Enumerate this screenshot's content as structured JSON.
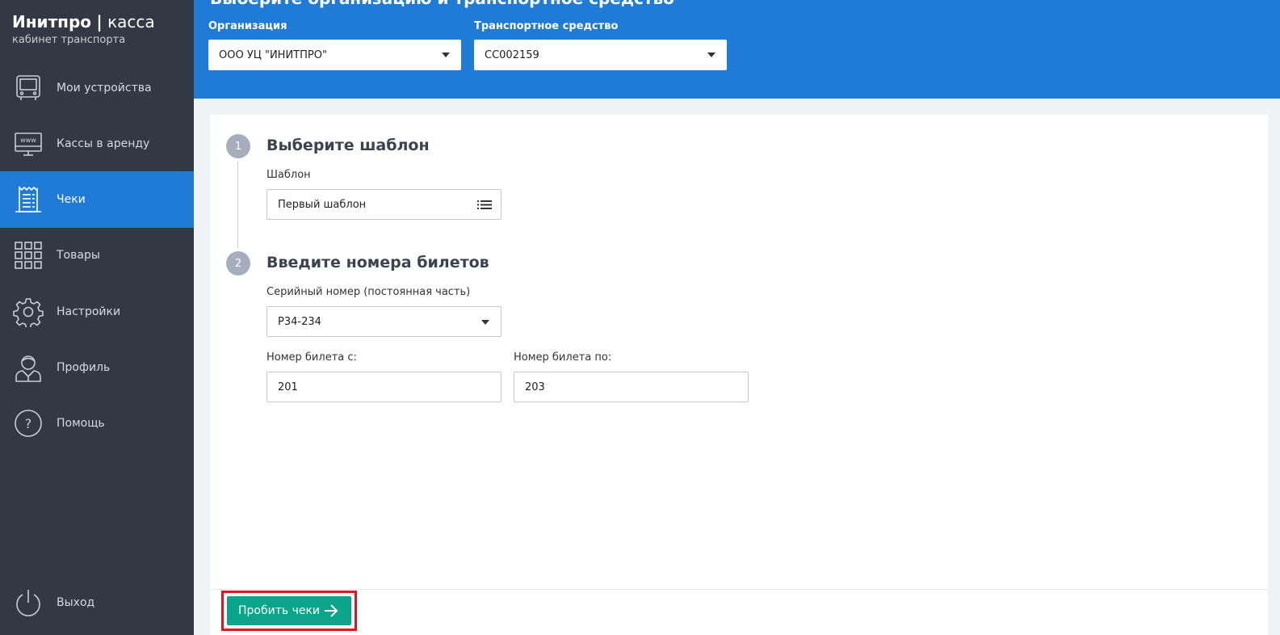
{
  "brand": {
    "title_bold": "Инитпро",
    "separator": "|",
    "title_light": "касса",
    "subtitle": "кабинет транспорта"
  },
  "sidebar": {
    "items": [
      {
        "label": "Мои устройства",
        "icon": "bus-icon"
      },
      {
        "label": "Кассы в аренду",
        "icon": "www-monitor-icon"
      },
      {
        "label": "Чеки",
        "icon": "receipt-icon",
        "active": true
      },
      {
        "label": "Товары",
        "icon": "grid-icon"
      },
      {
        "label": "Настройки",
        "icon": "gear-icon"
      },
      {
        "label": "Профиль",
        "icon": "user-icon"
      },
      {
        "label": "Помощь",
        "icon": "help-icon"
      }
    ],
    "logout": {
      "label": "Выход",
      "icon": "power-icon"
    }
  },
  "header": {
    "title": "Выберите организацию и транспортное средство",
    "organization": {
      "label": "Организация",
      "value": "ООО УЦ \"ИНИТПРО\""
    },
    "vehicle": {
      "label": "Транспортное средство",
      "value": "СС002159"
    }
  },
  "steps": [
    {
      "number": "1",
      "title": "Выберите шаблон",
      "field_label": "Шаблон",
      "field_value": "Первый шаблон"
    },
    {
      "number": "2",
      "title": "Введите номера билетов",
      "serial": {
        "label": "Серийный номер (постоянная часть)",
        "value": "Р34-234"
      },
      "from": {
        "label": "Номер билета с:",
        "value": "201"
      },
      "to": {
        "label": "Номер билета по:",
        "value": "203"
      }
    }
  ],
  "actions": {
    "submit_label": "Пробить чеки"
  },
  "colors": {
    "sidebar": "#323844",
    "accent": "#1f7bd6",
    "submit": "#0aa58a",
    "highlight": "#e0161c"
  }
}
